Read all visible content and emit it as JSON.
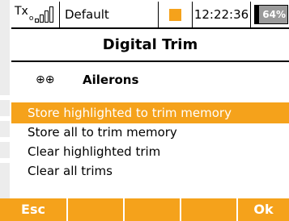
{
  "header": {
    "tx_label": "Tx",
    "model_name": "Default",
    "time": "12:22:36",
    "battery_percent": "64%",
    "signal_icon": "signal-bars-icon",
    "indicator_color": "#f5a21b"
  },
  "screen": {
    "title": "Digital Trim",
    "channel": {
      "icon": "ailerons-icon",
      "label": "Ailerons"
    },
    "menu": [
      {
        "label": "Store highlighted to trim memory",
        "selected": true
      },
      {
        "label": "Store all to trim memory",
        "selected": false
      },
      {
        "label": "Clear highlighted trim",
        "selected": false
      },
      {
        "label": "Clear all trims",
        "selected": false
      }
    ]
  },
  "softkeys": {
    "left": "Esc",
    "right": "Ok"
  },
  "colors": {
    "accent": "#f5a21b",
    "battery_fill": "#9a9a9a"
  }
}
